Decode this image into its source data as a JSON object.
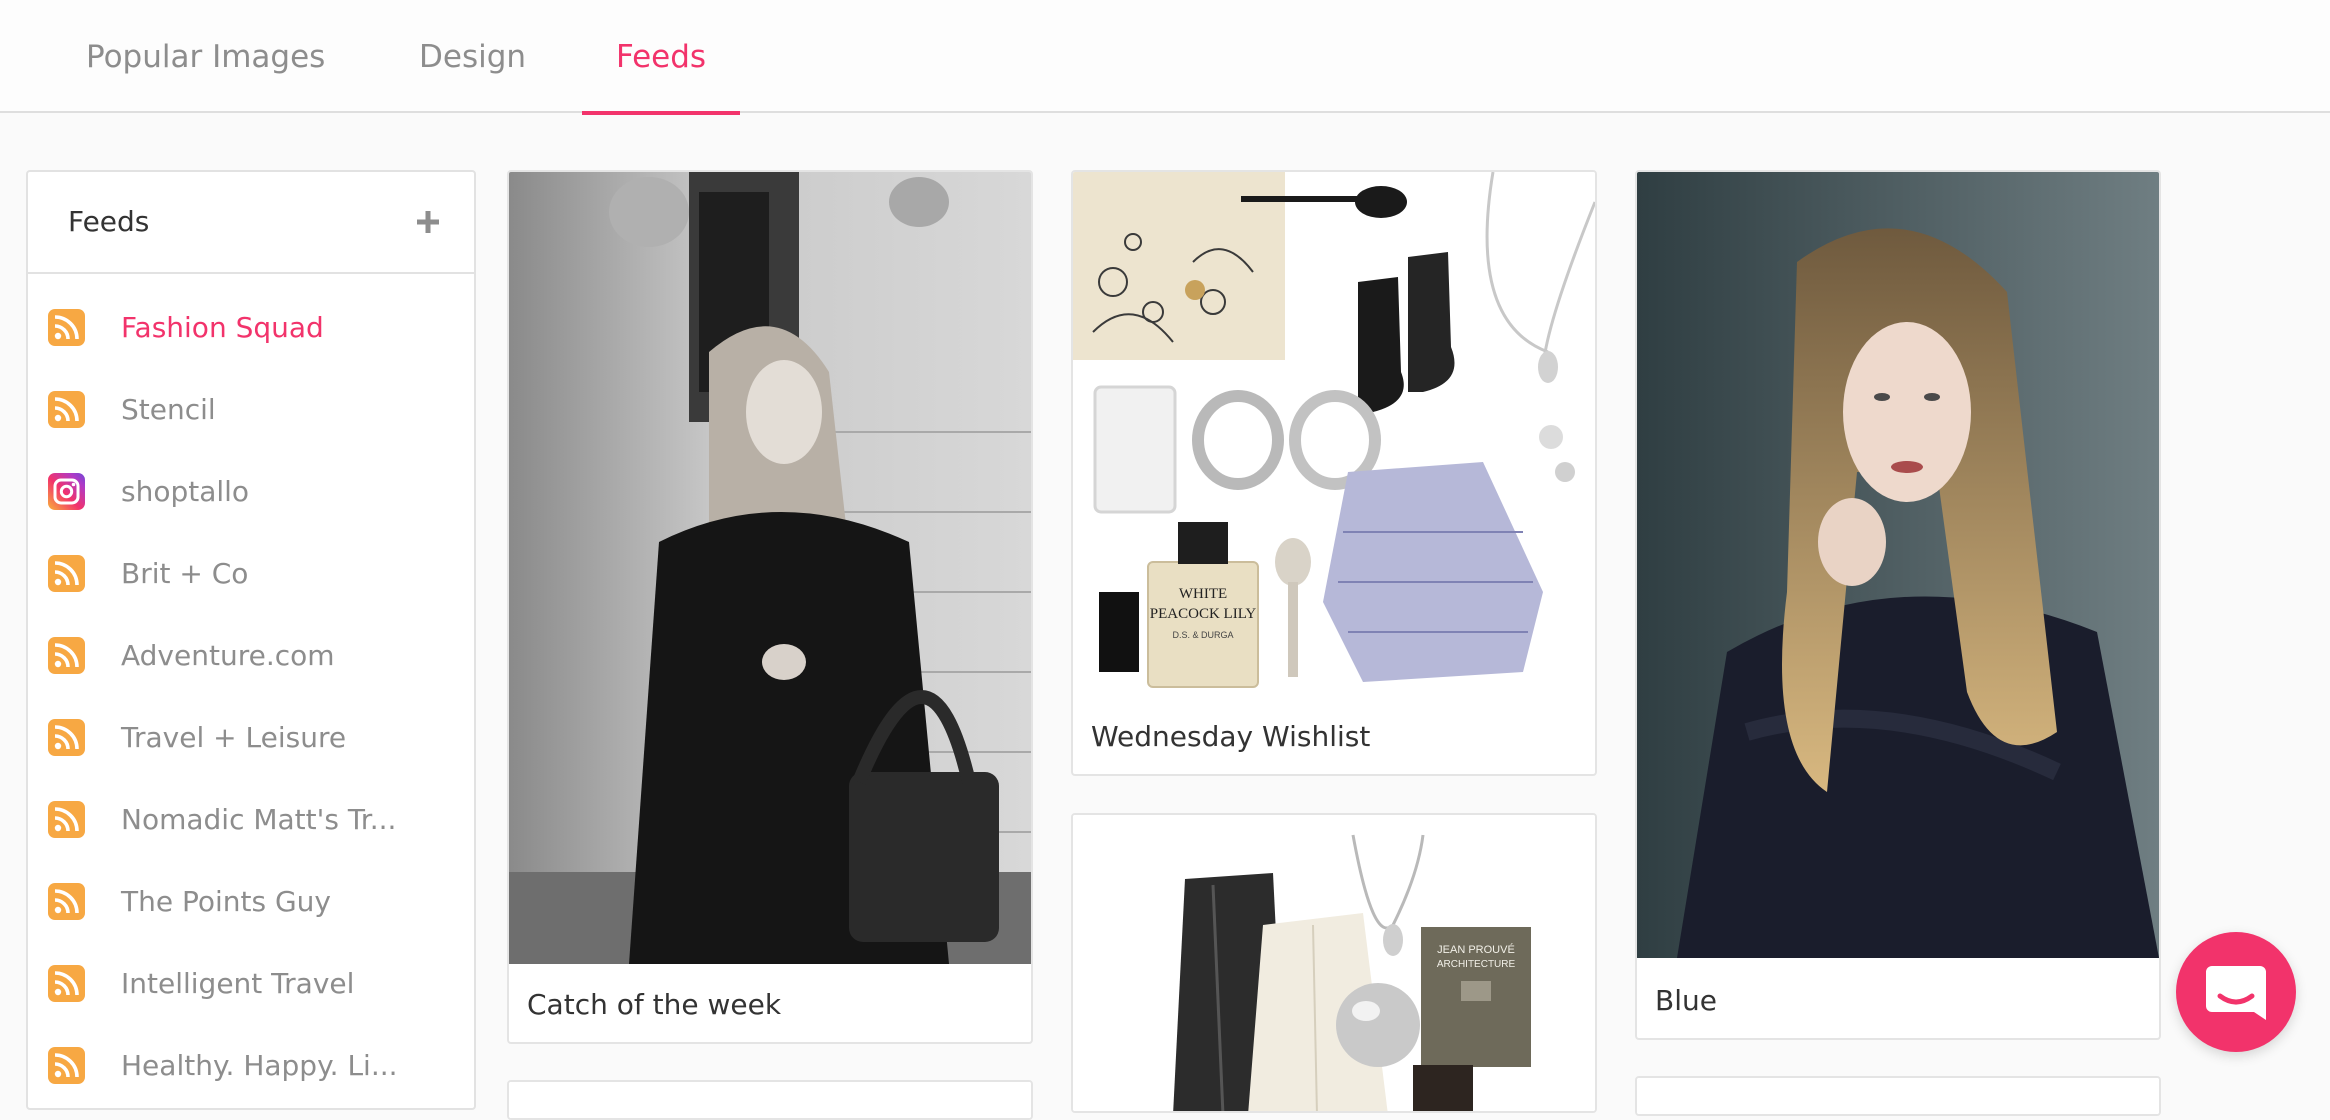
{
  "tabs": [
    {
      "label": "Popular Images",
      "active": false
    },
    {
      "label": "Design",
      "active": false
    },
    {
      "label": "Feeds",
      "active": true
    }
  ],
  "sidebar": {
    "title": "Feeds",
    "add_icon": "plus-icon",
    "items": [
      {
        "label": "Fashion Squad",
        "icon": "rss-icon",
        "active": true
      },
      {
        "label": "Stencil",
        "icon": "rss-icon",
        "active": false
      },
      {
        "label": "shoptallo",
        "icon": "instagram-icon",
        "active": false
      },
      {
        "label": "Brit + Co",
        "icon": "rss-icon",
        "active": false
      },
      {
        "label": "Adventure.com",
        "icon": "rss-icon",
        "active": false
      },
      {
        "label": "Travel + Leisure",
        "icon": "rss-icon",
        "active": false
      },
      {
        "label": "Nomadic Matt's Tr...",
        "icon": "rss-icon",
        "active": false
      },
      {
        "label": "The Points Guy",
        "icon": "rss-icon",
        "active": false
      },
      {
        "label": "Intelligent Travel",
        "icon": "rss-icon",
        "active": false
      },
      {
        "label": "Healthy. Happy. Li...",
        "icon": "rss-icon",
        "active": false
      }
    ]
  },
  "cards": [
    {
      "caption": "Catch of the week"
    },
    {
      "caption": "Wednesday Wishlist",
      "image_text": {
        "bottle_line1": "WHITE",
        "bottle_line2": "PEACOCK LILY",
        "bottle_brand": "D.S. & DURGA"
      }
    },
    {
      "caption": "Blue"
    },
    {
      "caption": "",
      "image_text": {
        "book_line1": "JEAN PROUVÉ",
        "book_line2": "ARCHITECTURE"
      }
    }
  ],
  "colors": {
    "accent": "#f2336b",
    "rss": "#f7a843",
    "tab_inactive": "#8d8d8d"
  },
  "chat_launcher": {
    "icon": "chat-icon"
  }
}
